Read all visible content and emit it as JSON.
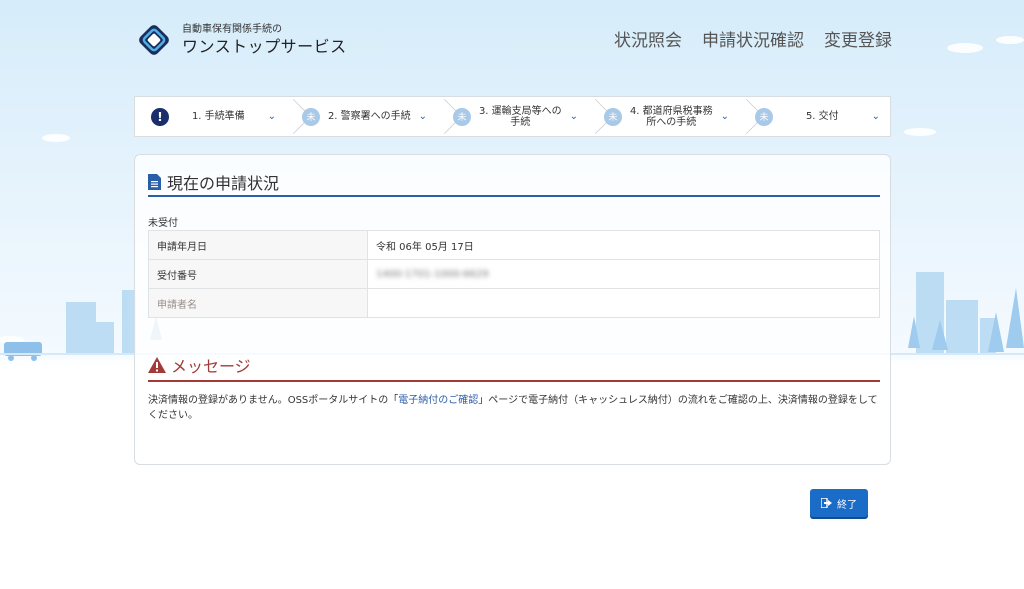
{
  "header": {
    "logo_sub": "自動車保有関係手続の",
    "logo_main": "ワンストップサービス",
    "nav": [
      "状況照会",
      "申請状況確認",
      "変更登録"
    ]
  },
  "steps": [
    {
      "badge": "!",
      "label": "1. 手続準備",
      "state": "alert"
    },
    {
      "badge": "未",
      "label": "2. 警察署への手続",
      "state": "pending"
    },
    {
      "badge": "未",
      "label": "3. 運輸支局等への手続",
      "state": "pending"
    },
    {
      "badge": "未",
      "label": "4. 都道府県税事務所への手続",
      "state": "pending"
    },
    {
      "badge": "未",
      "label": "5. 交付",
      "state": "pending"
    }
  ],
  "status_section": {
    "title": "現在の申請状況",
    "status": "未受付",
    "rows": [
      {
        "label": "申請年月日",
        "value": "令和 06年 05月 17日"
      },
      {
        "label": "受付番号",
        "value": "1400-1701-1000-6629"
      },
      {
        "label": "申請者名",
        "value": ""
      }
    ]
  },
  "message_section": {
    "title": "メッセージ",
    "text_before": "決済情報の登録がありません。OSSポータルサイトの「",
    "link_text": "電子納付のご確認",
    "text_after": "」ページで電子納付（キャッシュレス納付）の流れをご確認の上、決済情報の登録をしてください。"
  },
  "end_button": {
    "label": "終了",
    "icon": "exit-icon"
  },
  "colors": {
    "primary": "#2a5ea8",
    "alert": "#a23b38",
    "button": "#1a6cc6",
    "badge_alert": "#1a2e6b",
    "badge_pending": "#a9c9e8"
  }
}
